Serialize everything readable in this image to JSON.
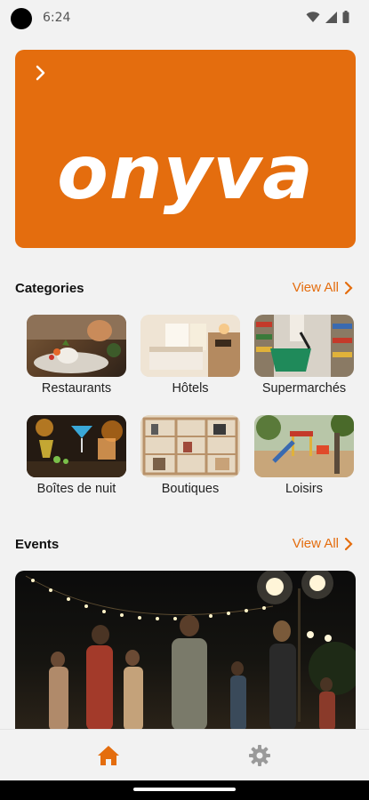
{
  "status_bar": {
    "time": "6:24",
    "icons": [
      "wifi-icon",
      "signal-icon",
      "battery-icon"
    ]
  },
  "hero": {
    "logo_text": "onyva",
    "background_color": "#e46d0e",
    "arrow_icon": "chevron-right-icon"
  },
  "categories": {
    "title": "Categories",
    "view_all": "View All",
    "items": [
      {
        "label": "Restaurants"
      },
      {
        "label": "Hôtels"
      },
      {
        "label": "Supermarchés"
      },
      {
        "label": "Boîtes de nuit"
      },
      {
        "label": "Boutiques"
      },
      {
        "label": "Loisirs"
      }
    ]
  },
  "events": {
    "title": "Events",
    "view_all": "View All"
  },
  "bottom_nav": {
    "items": [
      {
        "icon": "home-icon",
        "active": true
      },
      {
        "icon": "settings-icon",
        "active": false
      }
    ]
  },
  "colors": {
    "accent": "#e46d0e",
    "inactive_icon": "#9a9a9a"
  }
}
